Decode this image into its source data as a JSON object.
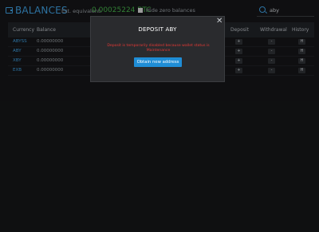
{
  "header": {
    "title": "BALANCES",
    "est_label": "Est. equivalent:",
    "est_value": "0.00025224 BTC",
    "hide_zero_label": "Hide zero balances",
    "search_value": "aby"
  },
  "table": {
    "columns": [
      "Currency",
      "Balance",
      "Deposit",
      "Withdrawal",
      "History"
    ],
    "rows": [
      {
        "currency": "ABYSS",
        "balance": "0.00000000",
        "deposit": "+",
        "withdrawal": "-",
        "history": "H"
      },
      {
        "currency": "ABY",
        "balance": "0.00000000",
        "deposit": "+",
        "withdrawal": "-",
        "history": "H"
      },
      {
        "currency": "XBY",
        "balance": "0.00000000",
        "deposit": "+",
        "withdrawal": "-",
        "history": "H"
      },
      {
        "currency": "EXB",
        "balance": "0.00000000",
        "deposit": "+",
        "withdrawal": "-",
        "history": "H"
      }
    ]
  },
  "modal": {
    "title": "DEPOSIT ABY",
    "message": "Deposit is temporarily disabled because wallet status is Maintenance",
    "button_label": "Obtain new address",
    "close_glyph": "✕"
  },
  "colors": {
    "accent": "#3f9fe0",
    "positive": "#46b04a",
    "error": "#e53935",
    "background": "#151618"
  },
  "icons": [
    "wallet-icon",
    "search-icon",
    "close-icon"
  ]
}
